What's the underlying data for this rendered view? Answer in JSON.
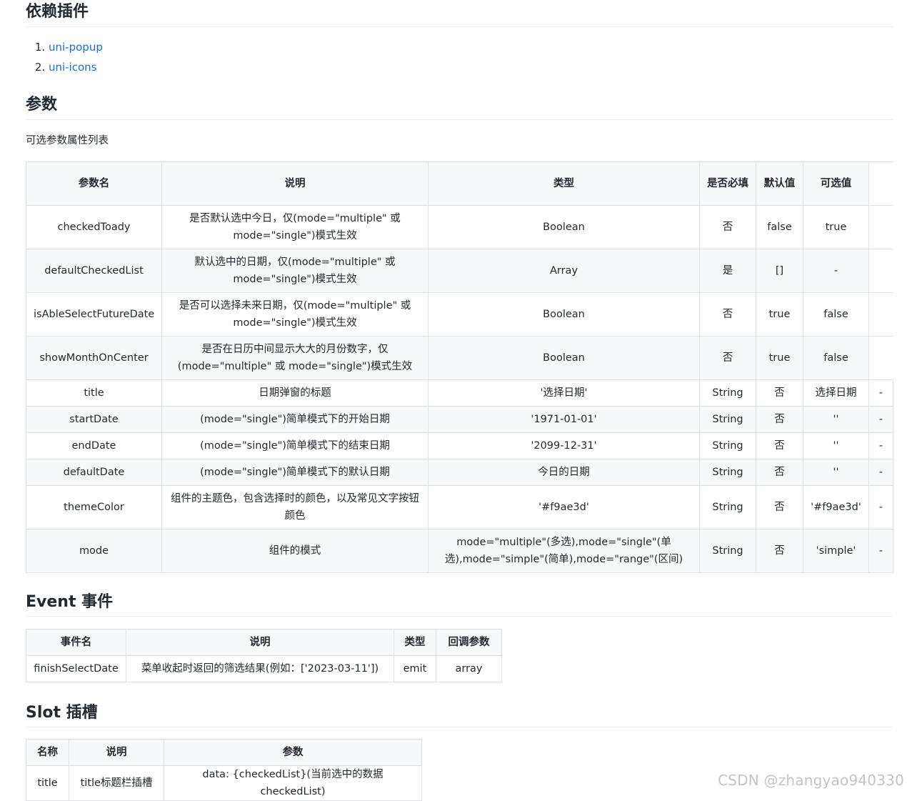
{
  "deps": {
    "title": "依赖插件",
    "items": [
      "uni-popup",
      "uni-icons"
    ]
  },
  "params": {
    "title": "参数",
    "desc": "可选参数属性列表",
    "headers": [
      "参数名",
      "说明",
      "类型",
      "是否必填",
      "默认值",
      "可选值"
    ],
    "rows": [
      [
        "checkedToady",
        "是否默认选中今日，仅(mode=\"multiple\" 或 mode=\"single\")模式生效",
        "Boolean",
        "否",
        "false",
        "true",
        ""
      ],
      [
        "defaultCheckedList",
        "默认选中的日期，仅(mode=\"multiple\" 或 mode=\"single\")模式生效",
        "Array",
        "是",
        "[]",
        "-",
        ""
      ],
      [
        "isAbleSelectFutureDate",
        "是否可以选择未来日期，仅(mode=\"multiple\" 或 mode=\"single\")模式生效",
        "Boolean",
        "否",
        "true",
        "false",
        ""
      ],
      [
        "showMonthOnCenter",
        "是否在日历中间显示大大的月份数字，仅(mode=\"multiple\" 或 mode=\"single\")模式生效",
        "Boolean",
        "否",
        "true",
        "false",
        ""
      ],
      [
        "title",
        "日期弹窗的标题",
        "'选择日期'",
        "String",
        "否",
        "选择日期",
        "-"
      ],
      [
        "startDate",
        "(mode=\"single\")简单模式下的开始日期",
        "'1971-01-01'",
        "String",
        "否",
        "''",
        "-"
      ],
      [
        "endDate",
        "(mode=\"single\")简单模式下的结束日期",
        "'2099-12-31'",
        "String",
        "否",
        "''",
        "-"
      ],
      [
        "defaultDate",
        "(mode=\"single\")简单模式下的默认日期",
        "今日的日期",
        "String",
        "否",
        "''",
        "-"
      ],
      [
        "themeColor",
        "组件的主题色，包含选择时的颜色，以及常见文字按钮颜色",
        "'#f9ae3d'",
        "String",
        "否",
        "'#f9ae3d'",
        "-"
      ],
      [
        "mode",
        "组件的模式",
        "mode=\"multiple\"(多选),mode=\"single\"(单选),mode=\"simple\"(简单),mode=\"range\"(区间)",
        "String",
        "否",
        "'simple'",
        "-"
      ]
    ]
  },
  "events": {
    "title": "Event 事件",
    "headers": [
      "事件名",
      "说明",
      "类型",
      "回调参数"
    ],
    "rows": [
      [
        "finishSelectDate",
        "菜单收起时返回的筛选结果(例如：['2023-03-11'])",
        "emit",
        "array"
      ]
    ]
  },
  "slots": {
    "title": "Slot 插槽",
    "headers": [
      "名称",
      "说明",
      "参数"
    ],
    "rows": [
      [
        "title",
        "title标题栏插槽",
        "data: {checkedList}(当前选中的数据checkedList)"
      ]
    ]
  },
  "watermark": "CSDN @zhangyao940330",
  "colors": {
    "link": "#1a6ed8",
    "header_bg": "#f6f8fa",
    "border": "#dfe2e5"
  }
}
